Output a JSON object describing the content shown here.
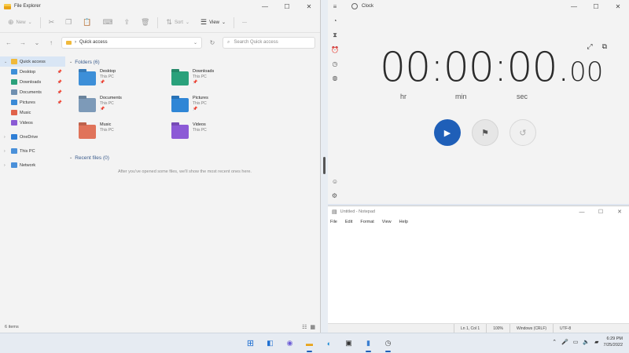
{
  "explorer": {
    "title": "File Explorer",
    "toolbar": {
      "new_label": "New",
      "sort_label": "Sort",
      "view_label": "View",
      "more_label": "···"
    },
    "address": "Quick access",
    "search_placeholder": "Search Quick access",
    "nav": [
      {
        "label": "Quick access",
        "level": 0,
        "selected": true,
        "color": "#f0b93b",
        "pinned": false
      },
      {
        "label": "Desktop",
        "level": 1,
        "color": "#3d8fd8",
        "pinned": true
      },
      {
        "label": "Downloads",
        "level": 1,
        "color": "#2aa17b",
        "pinned": true
      },
      {
        "label": "Documents",
        "level": 1,
        "color": "#6f8fb0",
        "pinned": true
      },
      {
        "label": "Pictures",
        "level": 1,
        "color": "#3a8ad6",
        "pinned": true
      },
      {
        "label": "Music",
        "level": 1,
        "color": "#e0624a",
        "pinned": false
      },
      {
        "label": "Videos",
        "level": 1,
        "color": "#8a5bd4",
        "pinned": false
      },
      {
        "label": "OneDrive",
        "level": 0,
        "color": "#2f7fd6",
        "pinned": false
      },
      {
        "label": "This PC",
        "level": 0,
        "color": "#4a90d9",
        "pinned": false
      },
      {
        "label": "Network",
        "level": 0,
        "color": "#4a90d9",
        "pinned": false
      }
    ],
    "folders_header": "Folders (6)",
    "folders": [
      {
        "name": "Desktop",
        "location": "This PC",
        "color": "#3d8fd8",
        "pinned": true
      },
      {
        "name": "Downloads",
        "location": "This PC",
        "color": "#2aa17b",
        "pinned": true
      },
      {
        "name": "Documents",
        "location": "This PC",
        "color": "#7d9ab8",
        "pinned": true
      },
      {
        "name": "Pictures",
        "location": "This PC",
        "color": "#2f86d6",
        "pinned": true
      },
      {
        "name": "Music",
        "location": "This PC",
        "color": "#e0735a",
        "pinned": false
      },
      {
        "name": "Videos",
        "location": "This PC",
        "color": "#8c5ad6",
        "pinned": false
      }
    ],
    "recent_header": "Recent files (0)",
    "recent_message": "After you've opened some files, we'll show the most recent ones here.",
    "status": "6 items"
  },
  "clock": {
    "title": "Clock",
    "timer_main": "00:00:00.",
    "timer_frac": "00",
    "unit_hr": "hr",
    "unit_min": "min",
    "unit_sec": "sec",
    "accent": "#1f5fb8"
  },
  "notepad": {
    "title": "Untitled - Notepad",
    "menu": [
      "File",
      "Edit",
      "Format",
      "View",
      "Help"
    ],
    "status_position": "Ln 1, Col 1",
    "status_zoom": "100%",
    "status_eol": "Windows (CRLF)",
    "status_encoding": "UTF-8"
  },
  "taskbar": {
    "time": "6:29 PM",
    "date": "7/25/2022"
  }
}
